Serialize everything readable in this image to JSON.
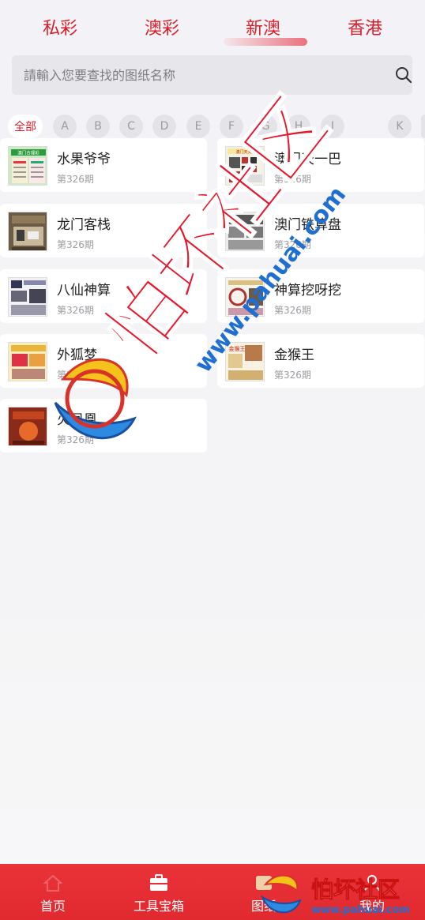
{
  "top_tabs": [
    "私彩",
    "澳彩",
    "新澳",
    "香港"
  ],
  "active_tab_index": 2,
  "search": {
    "placeholder": "請輸入您要查找的图纸名称"
  },
  "letters": [
    "全部",
    "A",
    "B",
    "C",
    "D",
    "E",
    "F",
    "G",
    "H",
    "I",
    "K"
  ],
  "items": [
    {
      "name": "水果爷爷",
      "issue": "第326期"
    },
    {
      "name": "澳门天一巴",
      "issue": "第326期"
    },
    {
      "name": "龙门客栈",
      "issue": "第326期"
    },
    {
      "name": "澳门铁算盘",
      "issue": "第326期"
    },
    {
      "name": "八仙神算",
      "issue": "第326期"
    },
    {
      "name": "神算挖呀挖",
      "issue": "第326期"
    },
    {
      "name": "外狐梦",
      "issue": "第326期"
    },
    {
      "name": "金猴王",
      "issue": "第326期"
    },
    {
      "name": "火凤凰",
      "issue": "第326期"
    }
  ],
  "thumb_texts": {
    "item0": "澳门合理彩",
    "item1": "澳门天天贝",
    "item7": "金猴王"
  },
  "bottom_nav": [
    {
      "label": "首页",
      "icon": "home-icon"
    },
    {
      "label": "工具宝箱",
      "icon": "toolbox-icon"
    },
    {
      "label": "图纸",
      "icon": "gallery-icon"
    },
    {
      "label": "我的",
      "icon": "user-icon"
    }
  ],
  "watermark": {
    "text": "怕坏社区",
    "url": "www.pahuai.com",
    "corner_url": "www.pahuai.com"
  },
  "colors": {
    "accent": "#d81e2b",
    "nav_bg": "#e52e34",
    "page_bg": "#f3f2f6"
  }
}
